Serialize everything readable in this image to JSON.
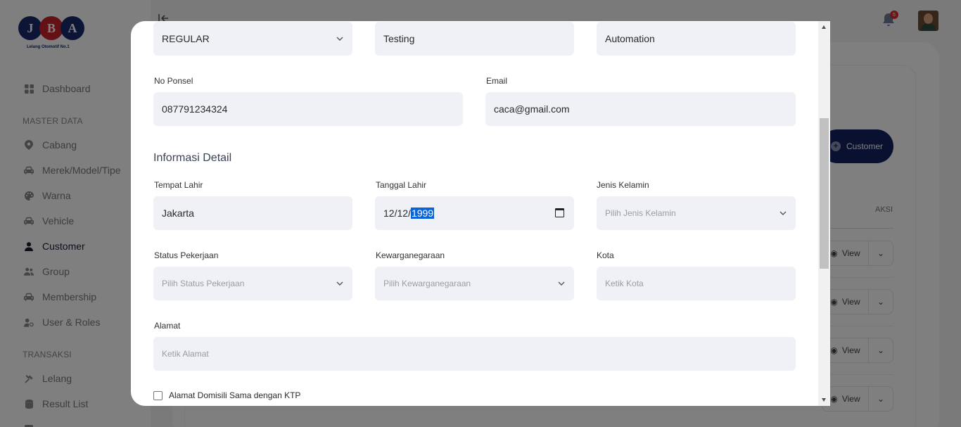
{
  "app": {
    "logo_letters": [
      "J",
      "B",
      "A"
    ],
    "logo_tagline": "Lelang Otomotif No.1",
    "notification_count": "5"
  },
  "sidebar": {
    "items_top": [
      {
        "label": "Dashboard",
        "icon": "dashboard-icon"
      }
    ],
    "section_master": "MASTER DATA",
    "items_master": [
      {
        "label": "Cabang",
        "icon": "location-pin-icon"
      },
      {
        "label": "Merek/Model/Tipe",
        "icon": "car-icon"
      },
      {
        "label": "Warna",
        "icon": "palette-icon"
      },
      {
        "label": "Vehicle",
        "icon": "car-icon"
      },
      {
        "label": "Customer",
        "icon": "user-icon",
        "active": true
      },
      {
        "label": "Group",
        "icon": "users-icon"
      },
      {
        "label": "Membership",
        "icon": "car-icon"
      },
      {
        "label": "User & Roles",
        "icon": "user-cog-icon"
      }
    ],
    "section_transaksi": "TRANSAKSI",
    "items_transaksi": [
      {
        "label": "Lelang",
        "icon": "gavel-icon"
      },
      {
        "label": "Result List",
        "icon": "database-icon"
      }
    ]
  },
  "background": {
    "customer_button": "Customer",
    "aksi_header": "AKSI",
    "view_label": "View"
  },
  "modal": {
    "row1": {
      "type_value": "REGULAR",
      "first_name_value": "Testing",
      "last_name_value": "Automation"
    },
    "no_ponsel_label": "No Ponsel",
    "no_ponsel_value": "087791234324",
    "email_label": "Email",
    "email_value": "caca@gmail.com",
    "section_title": "Informasi Detail",
    "tempat_lahir_label": "Tempat Lahir",
    "tempat_lahir_value": "Jakarta",
    "tanggal_lahir_label": "Tanggal Lahir",
    "tanggal_lahir_day": "12",
    "tanggal_lahir_month": "12",
    "tanggal_lahir_year": "1999",
    "jenis_kelamin_label": "Jenis Kelamin",
    "jenis_kelamin_placeholder": "Pilih Jenis Kelamin",
    "status_pekerjaan_label": "Status Pekerjaan",
    "status_pekerjaan_placeholder": "Pilih Status Pekerjaan",
    "kewarganegaraan_label": "Kewarganegaraan",
    "kewarganegaraan_placeholder": "Pilih Kewarganegaraan",
    "kota_label": "Kota",
    "kota_placeholder": "Ketik Kota",
    "alamat_label": "Alamat",
    "alamat_placeholder": "Ketik Alamat",
    "domisili_checkbox_label": "Alamat Domisili Sama dengan KTP",
    "domisili_checked": false
  }
}
